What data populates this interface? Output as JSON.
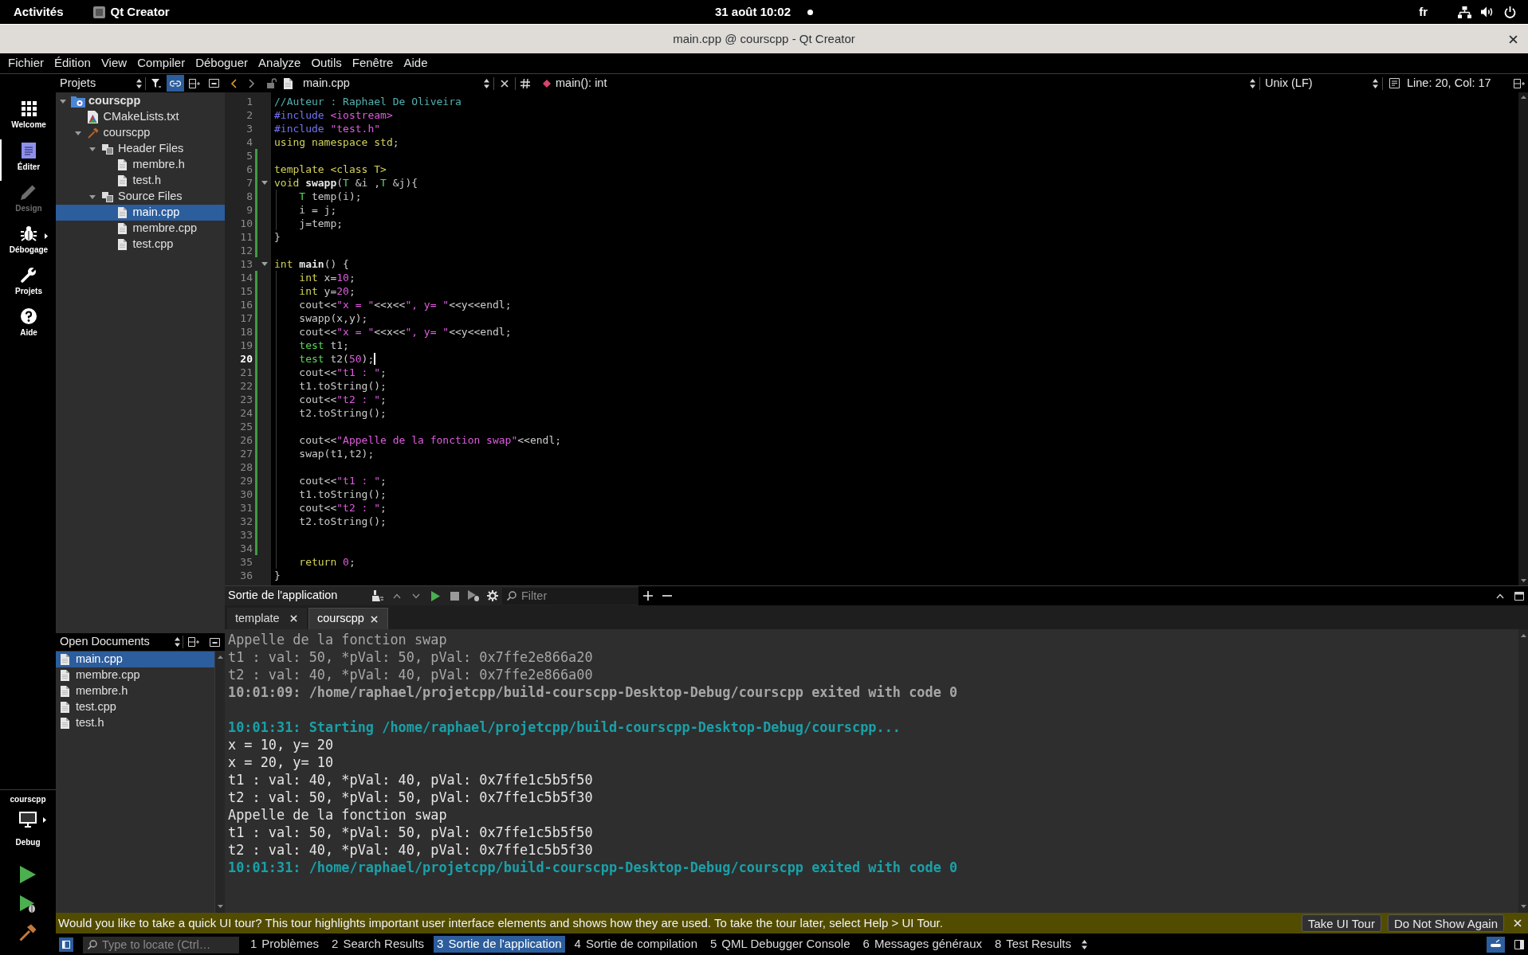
{
  "top_bar": {
    "activities": "Activités",
    "app": "Qt Creator",
    "clock": "31 août 10:02",
    "keyboard_layout": "fr"
  },
  "window": {
    "title": "main.cpp @ courscpp - Qt Creator"
  },
  "menu": [
    "Fichier",
    "Édition",
    "View",
    "Compiler",
    "Déboguer",
    "Analyze",
    "Outils",
    "Fenêtre",
    "Aide"
  ],
  "modes": [
    {
      "label": "Welcome",
      "selected": false,
      "disabled": false,
      "submenu": false
    },
    {
      "label": "Éditer",
      "selected": true,
      "disabled": false,
      "submenu": false
    },
    {
      "label": "Design",
      "selected": false,
      "disabled": true,
      "submenu": false
    },
    {
      "label": "Débogage",
      "selected": false,
      "disabled": false,
      "submenu": true
    },
    {
      "label": "Projets",
      "selected": false,
      "disabled": false,
      "submenu": false
    },
    {
      "label": "Aide",
      "selected": false,
      "disabled": false,
      "submenu": false
    }
  ],
  "kit": {
    "project": "courscpp",
    "build": "Debug"
  },
  "projects_pane": {
    "title": "Projets",
    "sync_with_editor": true,
    "tree": [
      {
        "label": "courscpp",
        "kind": "project",
        "expanded": true,
        "selected": false,
        "children": [
          {
            "label": "CMakeLists.txt",
            "kind": "cmake",
            "selected": false
          },
          {
            "label": "courscpp",
            "kind": "target",
            "expanded": true,
            "selected": false,
            "children": [
              {
                "label": "Header Files",
                "kind": "group",
                "expanded": true,
                "selected": false,
                "children": [
                  {
                    "label": "membre.h",
                    "kind": "file",
                    "selected": false
                  },
                  {
                    "label": "test.h",
                    "kind": "file",
                    "selected": false
                  }
                ]
              },
              {
                "label": "Source Files",
                "kind": "group",
                "expanded": true,
                "selected": false,
                "children": [
                  {
                    "label": "main.cpp",
                    "kind": "file",
                    "selected": true
                  },
                  {
                    "label": "membre.cpp",
                    "kind": "file",
                    "selected": false
                  },
                  {
                    "label": "test.cpp",
                    "kind": "file",
                    "selected": false
                  }
                ]
              }
            ]
          }
        ]
      }
    ]
  },
  "open_documents": {
    "title": "Open Documents",
    "items": [
      {
        "label": "main.cpp",
        "selected": true
      },
      {
        "label": "membre.cpp",
        "selected": false
      },
      {
        "label": "membre.h",
        "selected": false
      },
      {
        "label": "test.cpp",
        "selected": false
      },
      {
        "label": "test.h",
        "selected": false
      }
    ]
  },
  "editor": {
    "file": "main.cpp",
    "symbol": "main(): int",
    "line_ending": "Unix (LF)",
    "position": "Line: 20, Col: 17",
    "lines": [
      {
        "number": "1",
        "current": false,
        "changed": false,
        "fold": false,
        "tokens": [
          {
            "kind": "comment",
            "text": "//Auteur : Raphael De Oliveira"
          }
        ]
      },
      {
        "number": "2",
        "current": false,
        "changed": false,
        "fold": false,
        "tokens": [
          {
            "kind": "preprocessor",
            "text": "#include "
          },
          {
            "kind": "string",
            "text": "<iostream>"
          }
        ]
      },
      {
        "number": "3",
        "current": false,
        "changed": false,
        "fold": false,
        "tokens": [
          {
            "kind": "preprocessor",
            "text": "#include "
          },
          {
            "kind": "string",
            "text": "\"test.h\""
          }
        ]
      },
      {
        "number": "4",
        "current": false,
        "changed": false,
        "fold": false,
        "tokens": [
          {
            "kind": "keyword",
            "text": "using namespace std"
          },
          {
            "kind": "plain",
            "text": ";"
          }
        ]
      },
      {
        "number": "5",
        "current": false,
        "changed": true,
        "fold": false
      },
      {
        "number": "6",
        "current": false,
        "changed": true,
        "fold": false,
        "tokens": [
          {
            "kind": "keyword",
            "text": "template <class T>"
          }
        ]
      },
      {
        "number": "7",
        "current": false,
        "changed": true,
        "fold": true,
        "tokens": [
          {
            "kind": "keyword",
            "text": "void "
          },
          {
            "kind": "function",
            "text": "swapp"
          },
          {
            "kind": "plain",
            "text": "("
          },
          {
            "kind": "type",
            "text": "T"
          },
          {
            "kind": "plain",
            "text": " &i ,"
          },
          {
            "kind": "type",
            "text": "T"
          },
          {
            "kind": "plain",
            "text": " &j){"
          }
        ]
      },
      {
        "number": "8",
        "current": false,
        "changed": true,
        "fold": false,
        "tokens": [
          {
            "kind": "type",
            "text": "    T"
          },
          {
            "kind": "plain",
            "text": " temp(i);"
          }
        ]
      },
      {
        "number": "9",
        "current": false,
        "changed": true,
        "fold": false,
        "tokens": [
          {
            "kind": "plain",
            "text": "    i = j;"
          }
        ]
      },
      {
        "number": "10",
        "current": false,
        "changed": true,
        "fold": false,
        "tokens": [
          {
            "kind": "plain",
            "text": "    j=temp;"
          }
        ]
      },
      {
        "number": "11",
        "current": false,
        "changed": true,
        "fold": false,
        "tokens": [
          {
            "kind": "plain",
            "text": "}"
          }
        ]
      },
      {
        "number": "12",
        "current": false,
        "changed": true,
        "fold": false
      },
      {
        "number": "13",
        "current": false,
        "changed": false,
        "fold": true,
        "tokens": [
          {
            "kind": "keyword",
            "text": "int "
          },
          {
            "kind": "function",
            "text": "main"
          },
          {
            "kind": "plain",
            "text": "() {"
          }
        ]
      },
      {
        "number": "14",
        "current": false,
        "changed": true,
        "fold": false,
        "tokens": [
          {
            "kind": "keyword",
            "text": "    int"
          },
          {
            "kind": "plain",
            "text": " x="
          },
          {
            "kind": "number",
            "text": "10"
          },
          {
            "kind": "plain",
            "text": ";"
          }
        ]
      },
      {
        "number": "15",
        "current": false,
        "changed": true,
        "fold": false,
        "tokens": [
          {
            "kind": "keyword",
            "text": "    int"
          },
          {
            "kind": "plain",
            "text": " y="
          },
          {
            "kind": "number",
            "text": "20"
          },
          {
            "kind": "plain",
            "text": ";"
          }
        ]
      },
      {
        "number": "16",
        "current": false,
        "changed": true,
        "fold": false,
        "tokens": [
          {
            "kind": "plain",
            "text": "    cout<<"
          },
          {
            "kind": "string",
            "text": "\"x = \""
          },
          {
            "kind": "plain",
            "text": "<<x<<"
          },
          {
            "kind": "string",
            "text": "\", y= \""
          },
          {
            "kind": "plain",
            "text": "<<y<<endl;"
          }
        ]
      },
      {
        "number": "17",
        "current": false,
        "changed": true,
        "fold": false,
        "tokens": [
          {
            "kind": "plain",
            "text": "    swapp(x,y);"
          }
        ]
      },
      {
        "number": "18",
        "current": false,
        "changed": true,
        "fold": false,
        "tokens": [
          {
            "kind": "plain",
            "text": "    cout<<"
          },
          {
            "kind": "string",
            "text": "\"x = \""
          },
          {
            "kind": "plain",
            "text": "<<x<<"
          },
          {
            "kind": "string",
            "text": "\", y= \""
          },
          {
            "kind": "plain",
            "text": "<<y<<endl;"
          }
        ]
      },
      {
        "number": "19",
        "current": false,
        "changed": true,
        "fold": false,
        "tokens": [
          {
            "kind": "type",
            "text": "    test"
          },
          {
            "kind": "plain",
            "text": " t1;"
          }
        ]
      },
      {
        "number": "20",
        "current": true,
        "changed": true,
        "fold": false,
        "tokens": [
          {
            "kind": "type",
            "text": "    test"
          },
          {
            "kind": "plain",
            "text": " t2("
          },
          {
            "kind": "number",
            "text": "50"
          },
          {
            "kind": "plain",
            "text": ");"
          }
        ]
      },
      {
        "number": "21",
        "current": false,
        "changed": true,
        "fold": false,
        "tokens": [
          {
            "kind": "plain",
            "text": "    cout<<"
          },
          {
            "kind": "string",
            "text": "\"t1 : \""
          },
          {
            "kind": "plain",
            "text": ";"
          }
        ]
      },
      {
        "number": "22",
        "current": false,
        "changed": true,
        "fold": false,
        "tokens": [
          {
            "kind": "plain",
            "text": "    t1.toString();"
          }
        ]
      },
      {
        "number": "23",
        "current": false,
        "changed": true,
        "fold": false,
        "tokens": [
          {
            "kind": "plain",
            "text": "    cout<<"
          },
          {
            "kind": "string",
            "text": "\"t2 : \""
          },
          {
            "kind": "plain",
            "text": ";"
          }
        ]
      },
      {
        "number": "24",
        "current": false,
        "changed": true,
        "fold": false,
        "tokens": [
          {
            "kind": "plain",
            "text": "    t2.toString();"
          }
        ]
      },
      {
        "number": "25",
        "current": false,
        "changed": true,
        "fold": false
      },
      {
        "number": "26",
        "current": false,
        "changed": true,
        "fold": false,
        "tokens": [
          {
            "kind": "plain",
            "text": "    cout<<"
          },
          {
            "kind": "string",
            "text": "\"Appelle de la fonction swap\""
          },
          {
            "kind": "plain",
            "text": "<<endl;"
          }
        ]
      },
      {
        "number": "27",
        "current": false,
        "changed": true,
        "fold": false,
        "tokens": [
          {
            "kind": "plain",
            "text": "    swap(t1,t2);"
          }
        ]
      },
      {
        "number": "28",
        "current": false,
        "changed": true,
        "fold": false
      },
      {
        "number": "29",
        "current": false,
        "changed": true,
        "fold": false,
        "tokens": [
          {
            "kind": "plain",
            "text": "    cout<<"
          },
          {
            "kind": "string",
            "text": "\"t1 : \""
          },
          {
            "kind": "plain",
            "text": ";"
          }
        ]
      },
      {
        "number": "30",
        "current": false,
        "changed": true,
        "fold": false,
        "tokens": [
          {
            "kind": "plain",
            "text": "    t1.toString();"
          }
        ]
      },
      {
        "number": "31",
        "current": false,
        "changed": true,
        "fold": false,
        "tokens": [
          {
            "kind": "plain",
            "text": "    cout<<"
          },
          {
            "kind": "string",
            "text": "\"t2 : \""
          },
          {
            "kind": "plain",
            "text": ";"
          }
        ]
      },
      {
        "number": "32",
        "current": false,
        "changed": true,
        "fold": false,
        "tokens": [
          {
            "kind": "plain",
            "text": "    t2.toString();"
          }
        ]
      },
      {
        "number": "33",
        "current": false,
        "changed": true,
        "fold": false
      },
      {
        "number": "34",
        "current": false,
        "changed": true,
        "fold": false
      },
      {
        "number": "35",
        "current": false,
        "changed": false,
        "fold": false,
        "tokens": [
          {
            "kind": "keyword",
            "text": "    return "
          },
          {
            "kind": "number",
            "text": "0"
          },
          {
            "kind": "plain",
            "text": ";"
          }
        ]
      },
      {
        "number": "36",
        "current": false,
        "changed": false,
        "fold": false,
        "tokens": [
          {
            "kind": "plain",
            "text": "}"
          }
        ]
      }
    ]
  },
  "output": {
    "title": "Sortie de l'application",
    "filter_placeholder": "Filter",
    "tabs": [
      {
        "label": "template",
        "selected": false
      },
      {
        "label": "courscpp",
        "selected": true
      }
    ],
    "previous_run": [
      {
        "kind": "message",
        "text": "Appelle de la fonction swap"
      },
      {
        "kind": "message",
        "text": "t1 : val: 50, *pVal: 50, pVal: 0x7ffe2e866a20"
      },
      {
        "kind": "message",
        "text": "t2 : val: 40, *pVal: 40, pVal: 0x7ffe2e866a00"
      },
      {
        "kind": "status",
        "text": "10:01:09: /home/raphael/projetcpp/build-courscpp-Desktop-Debug/courscpp exited with code 0"
      }
    ],
    "current_run": [
      {
        "kind": "status",
        "text": "10:01:31: Starting /home/raphael/projetcpp/build-courscpp-Desktop-Debug/courscpp..."
      },
      {
        "kind": "message",
        "text": "x = 10, y= 20"
      },
      {
        "kind": "message",
        "text": "x = 20, y= 10"
      },
      {
        "kind": "message",
        "text": "t1 : val: 40, *pVal: 40, pVal: 0x7ffe1c5b5f50"
      },
      {
        "kind": "message",
        "text": "t2 : val: 50, *pVal: 50, pVal: 0x7ffe1c5b5f30"
      },
      {
        "kind": "message",
        "text": "Appelle de la fonction swap"
      },
      {
        "kind": "message",
        "text": "t1 : val: 50, *pVal: 50, pVal: 0x7ffe1c5b5f50"
      },
      {
        "kind": "message",
        "text": "t2 : val: 40, *pVal: 40, pVal: 0x7ffe1c5b5f30"
      },
      {
        "kind": "status",
        "text": "10:01:31: /home/raphael/projetcpp/build-courscpp-Desktop-Debug/courscpp exited with code 0"
      }
    ]
  },
  "banner": {
    "text": "Would you like to take a quick UI tour? This tour highlights important user interface elements and shows how they are used. To take the tour later, select Help > UI Tour.",
    "buttons": [
      "Take UI Tour",
      "Do Not Show Again"
    ]
  },
  "status_bar": {
    "locator_placeholder": "Type to locate (Ctrl…",
    "panes": [
      {
        "number": "1",
        "label": "Problèmes",
        "selected": false
      },
      {
        "number": "2",
        "label": "Search Results",
        "selected": false
      },
      {
        "number": "3",
        "label": "Sortie de l'application",
        "selected": true
      },
      {
        "number": "4",
        "label": "Sortie de compilation",
        "selected": false
      },
      {
        "number": "5",
        "label": "QML Debugger Console",
        "selected": false
      },
      {
        "number": "6",
        "label": "Messages généraux",
        "selected": false
      },
      {
        "number": "8",
        "label": "Test Results",
        "selected": false
      }
    ]
  }
}
